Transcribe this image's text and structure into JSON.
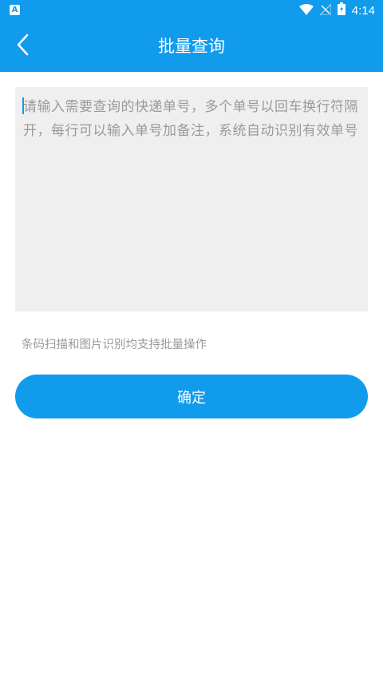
{
  "status_bar": {
    "app_icon_letter": "A",
    "time": "4:14",
    "icons": [
      "wifi-icon",
      "signal-icon",
      "battery-icon"
    ]
  },
  "app_bar": {
    "title": "批量查询",
    "back_icon": "chevron-left-icon"
  },
  "input": {
    "placeholder": "请输入需要查询的快递单号，多个单号以回车换行符隔开，每行可以输入单号加备注，系统自动识别有效单号",
    "value": ""
  },
  "hint_text": "条码扫描和图片识别均支持批量操作",
  "confirm_button": {
    "label": "确定"
  },
  "colors": {
    "primary": "#109bed",
    "input_bg": "#efefef",
    "hint_text": "#9a9a9a",
    "background": "#ffffff"
  }
}
